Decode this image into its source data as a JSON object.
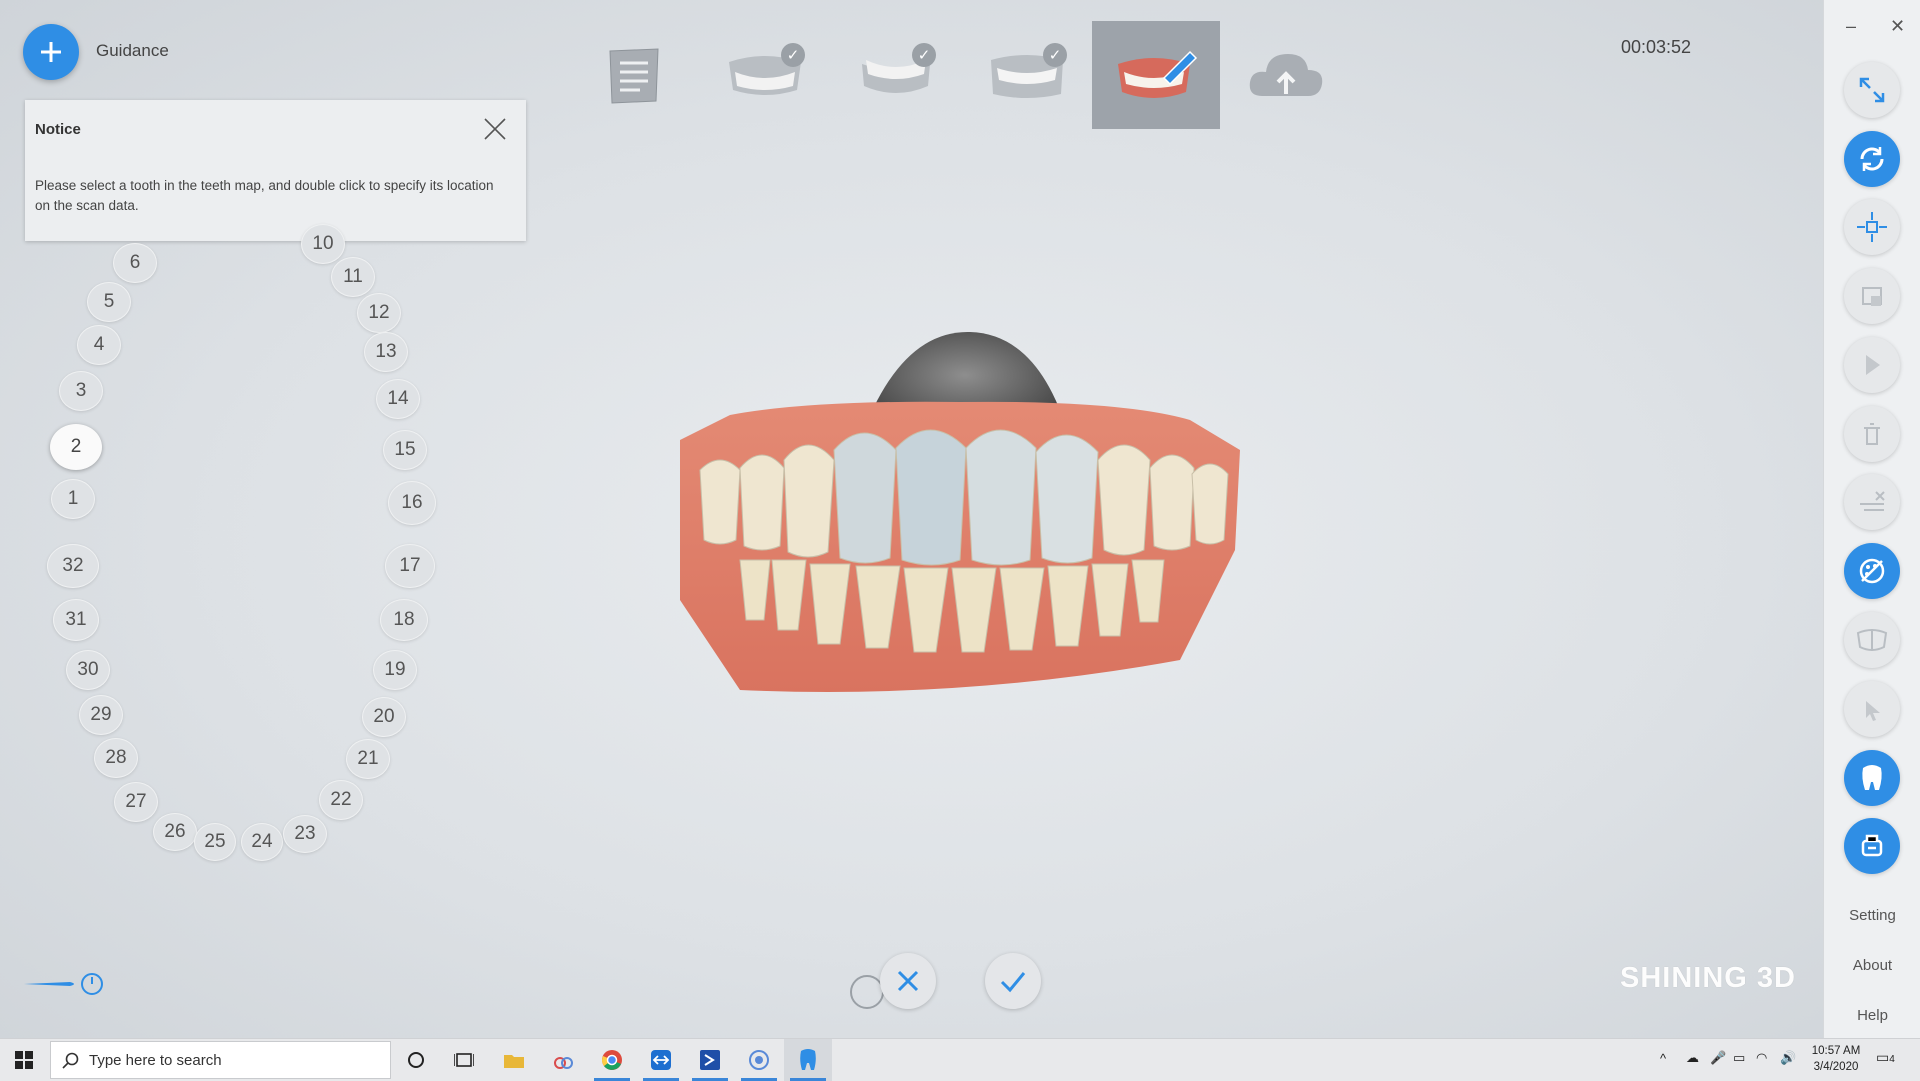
{
  "guidance": {
    "label": "Guidance"
  },
  "notice": {
    "title": "Notice",
    "text": "Please select a tooth in the teeth map, and double click to specify its location on the scan data."
  },
  "teeth": [
    "10",
    "6",
    "11",
    "5",
    "12",
    "4",
    "13",
    "3",
    "14",
    "2",
    "15",
    "1",
    "16",
    "32",
    "17",
    "31",
    "18",
    "30",
    "19",
    "29",
    "20",
    "28",
    "21",
    "27",
    "22",
    "26",
    "25",
    "24",
    "23"
  ],
  "selected_tooth": "2",
  "steps": [
    {
      "name": "order-info",
      "checked": false,
      "active": false
    },
    {
      "name": "upper-jaw",
      "checked": true,
      "active": false
    },
    {
      "name": "lower-jaw",
      "checked": true,
      "active": false
    },
    {
      "name": "occlusion",
      "checked": true,
      "active": false
    },
    {
      "name": "tooth-marking",
      "checked": false,
      "active": true
    },
    {
      "name": "upload",
      "checked": false,
      "active": false
    }
  ],
  "timer": "00:03:52",
  "toolbar": {
    "setting_label": "Setting",
    "about_label": "About",
    "help_label": "Help",
    "buttons": [
      "fullscreen",
      "rotate",
      "pan",
      "lock",
      "select",
      "delete",
      "trim",
      "texture",
      "bite",
      "cursor",
      "tooth",
      "scanner"
    ],
    "active_buttons": [
      "rotate",
      "texture",
      "tooth",
      "scanner"
    ]
  },
  "brand": "SHINING 3D",
  "taskbar": {
    "search_placeholder": "Type here to search",
    "time": "10:57 AM",
    "date": "3/4/2020",
    "notification_count": "4"
  },
  "colors": {
    "accent": "#2f8ee5",
    "active_step": "#9da3aa"
  }
}
